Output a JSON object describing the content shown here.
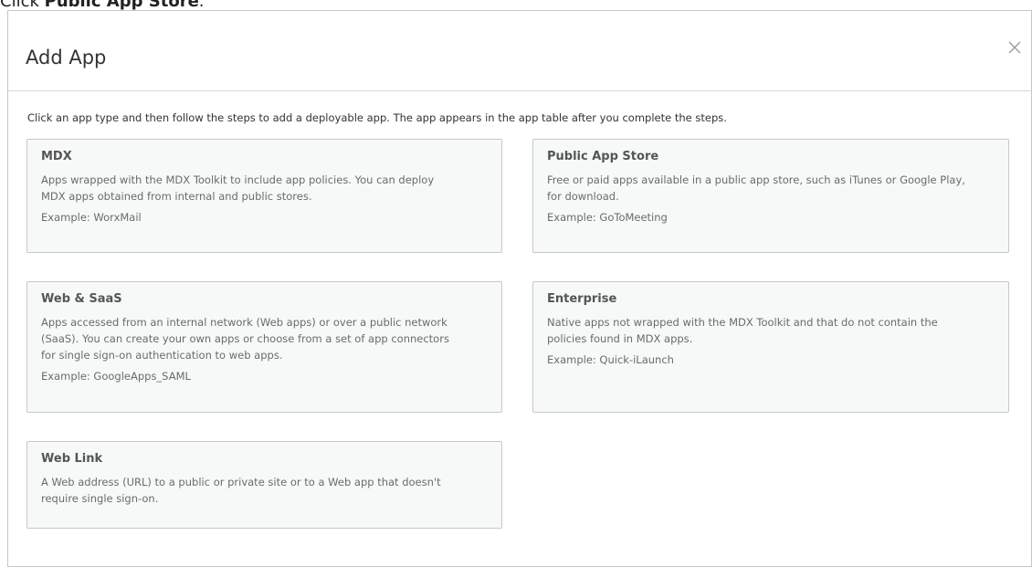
{
  "instruction": {
    "prefix": "Click ",
    "bold": "Public App Store",
    "suffix": "."
  },
  "dialog": {
    "title": "Add App",
    "close_icon": "close-icon",
    "description": "Click an app type and then follow the steps to add a deployable app. The app appears in the app table after you complete the steps."
  },
  "cards": {
    "mdx": {
      "title": "MDX",
      "description": "Apps wrapped with the MDX Toolkit to include app policies. You can deploy\nMDX apps obtained from internal and public stores.",
      "example": "Example: WorxMail"
    },
    "public_app_store": {
      "title": "Public App Store",
      "description": "Free or paid apps available in a public app store, such as iTunes or Google Play,\nfor download.",
      "example": "Example: GoToMeeting"
    },
    "web_saas": {
      "title": "Web & SaaS",
      "description": "Apps accessed from an internal network (Web apps) or over a public network\n(SaaS). You can create your own apps or choose from a set of app connectors\nfor single sign-on authentication to web apps.",
      "example": "Example: GoogleApps_SAML"
    },
    "enterprise": {
      "title": "Enterprise",
      "description": "Native apps not wrapped with the MDX Toolkit and that do not contain the\npolicies found in MDX apps.",
      "example": "Example: Quick-iLaunch"
    },
    "web_link": {
      "title": "Web Link",
      "description": "A Web address (URL) to a public or private site or to a Web app that doesn't\nrequire single sign-on."
    }
  },
  "colors": {
    "card_background": "#f7f9f9",
    "card_border": "#c8c8c8",
    "title_text": "#555555",
    "body_text": "#6a6a6a"
  }
}
